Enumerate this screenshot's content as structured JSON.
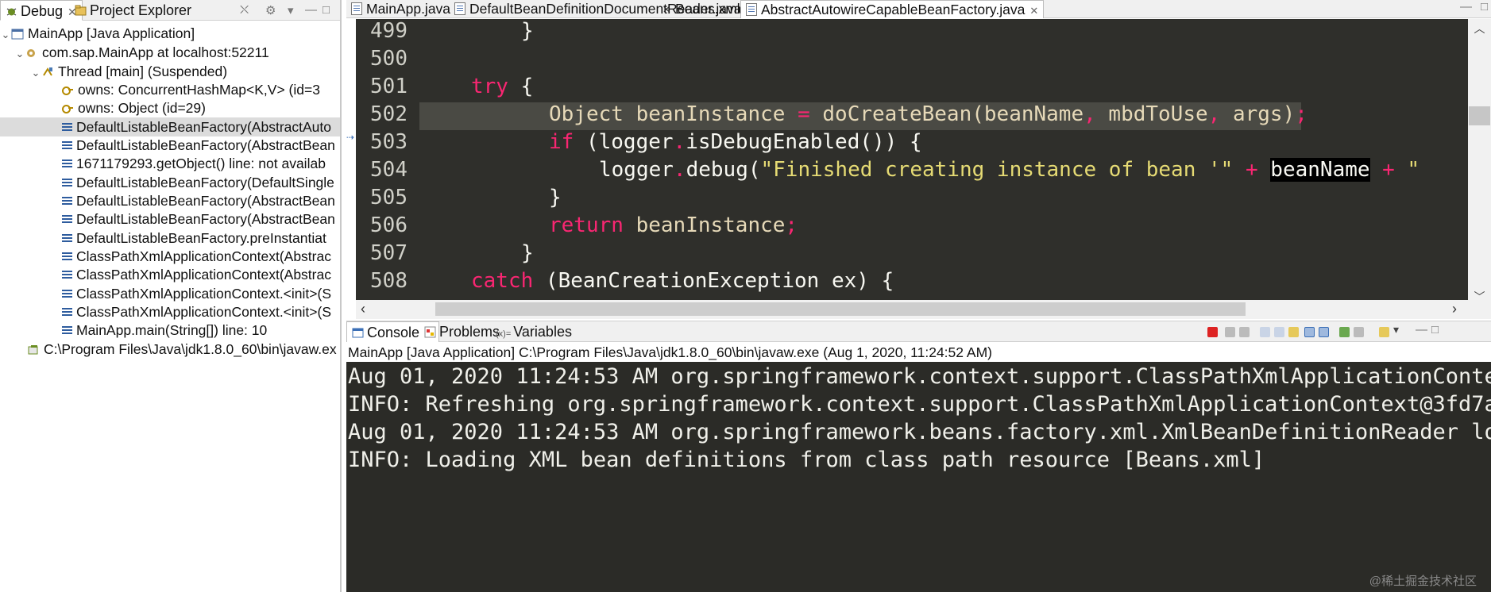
{
  "debug_view": {
    "tabs": [
      {
        "label": "Debug",
        "active": true
      },
      {
        "label": "Project Explorer",
        "active": false
      }
    ],
    "tree": [
      {
        "label": "MainApp [Java Application]",
        "level": 0,
        "expanded": true,
        "icon": "launch-icon"
      },
      {
        "label": "com.sap.MainApp at localhost:52211",
        "level": 1,
        "expanded": true,
        "icon": "target-icon"
      },
      {
        "label": "Thread [main] (Suspended)",
        "level": 2,
        "expanded": true,
        "icon": "thread-icon"
      },
      {
        "label": "owns: ConcurrentHashMap<K,V>  (id=3",
        "level": 3,
        "icon": "monitor-icon"
      },
      {
        "label": "owns: Object  (id=29)",
        "level": 3,
        "icon": "monitor-icon"
      },
      {
        "label": "DefaultListableBeanFactory(AbstractAuto",
        "level": 3,
        "icon": "stack-frame-icon",
        "selected": true
      },
      {
        "label": "DefaultListableBeanFactory(AbstractBean",
        "level": 3,
        "icon": "stack-frame-icon"
      },
      {
        "label": "1671179293.getObject() line: not availab",
        "level": 3,
        "icon": "stack-frame-icon"
      },
      {
        "label": "DefaultListableBeanFactory(DefaultSingle",
        "level": 3,
        "icon": "stack-frame-icon"
      },
      {
        "label": "DefaultListableBeanFactory(AbstractBean",
        "level": 3,
        "icon": "stack-frame-icon"
      },
      {
        "label": "DefaultListableBeanFactory(AbstractBean",
        "level": 3,
        "icon": "stack-frame-icon"
      },
      {
        "label": "DefaultListableBeanFactory.preInstantiat",
        "level": 3,
        "icon": "stack-frame-icon"
      },
      {
        "label": "ClassPathXmlApplicationContext(Abstrac",
        "level": 3,
        "icon": "stack-frame-icon"
      },
      {
        "label": "ClassPathXmlApplicationContext(Abstrac",
        "level": 3,
        "icon": "stack-frame-icon"
      },
      {
        "label": "ClassPathXmlApplicationContext.<init>(S",
        "level": 3,
        "icon": "stack-frame-icon"
      },
      {
        "label": "ClassPathXmlApplicationContext.<init>(S",
        "level": 3,
        "icon": "stack-frame-icon"
      },
      {
        "label": "MainApp.main(String[]) line: 10",
        "level": 3,
        "icon": "stack-frame-icon"
      },
      {
        "label": "C:\\Program Files\\Java\\jdk1.8.0_60\\bin\\javaw.ex",
        "level": 1,
        "icon": "process-icon"
      }
    ]
  },
  "editor": {
    "tabs": [
      {
        "label": "MainApp.java",
        "icon": "java-file-icon",
        "active": false
      },
      {
        "label": "DefaultBeanDefinitionDocumentReader.java",
        "icon": "java-file-icon",
        "active": false
      },
      {
        "label": "Beans.xml",
        "icon": "xml-file-icon",
        "active": false
      },
      {
        "label": "AbstractAutowireCapableBeanFactory.java",
        "icon": "java-file-icon",
        "active": true
      }
    ],
    "line_numbers": [
      "499",
      "500",
      "501",
      "502",
      "503",
      "504",
      "505",
      "506",
      "507",
      "508"
    ],
    "code": {
      "l499": "}",
      "l501_kw": "try",
      "l501_rest": " {",
      "l502_a": "Object beanInstance ",
      "l502_eq": "=",
      "l502_b": " doCreateBean(beanName",
      "l502_c1": ",",
      "l502_d": " mbdToUse",
      "l502_c2": ",",
      "l502_e": " args)",
      "l502_semi": ";",
      "l503_kw": "if",
      "l503_rest": " (logger",
      "l503_dot": ".",
      "l503_rest2": "isDebugEnabled()) {",
      "l504_a": "logger",
      "l504_dot": ".",
      "l504_b": "debug(",
      "l504_str": "\"Finished creating instance of bean '\"",
      "l504_plus1": " + ",
      "l504_sel": "beanName",
      "l504_plus2": " + ",
      "l504_tail": "\"",
      "l505": "}",
      "l506_kw": "return",
      "l506_rest": " beanInstance",
      "l506_semi": ";",
      "l507": "}",
      "l508_kw": "catch",
      "l508_rest": " (BeanCreationException ex) {"
    }
  },
  "console": {
    "tabs": [
      {
        "label": "Console",
        "active": true
      },
      {
        "label": "Problems",
        "active": false
      },
      {
        "label": "Variables",
        "active": false
      }
    ],
    "title": "MainApp [Java Application] C:\\Program Files\\Java\\jdk1.8.0_60\\bin\\javaw.exe (Aug 1, 2020, 11:24:52 AM)",
    "lines": [
      "Aug 01, 2020 11:24:53 AM org.springframework.context.support.ClassPathXmlApplicationConte",
      "INFO: Refreshing org.springframework.context.support.ClassPathXmlApplicationContext@3fd7a",
      "Aug 01, 2020 11:24:53 AM org.springframework.beans.factory.xml.XmlBeanDefinitionReader lo",
      "INFO: Loading XML bean definitions from class path resource [Beans.xml]"
    ]
  },
  "watermark": "@稀土掘金技术社区",
  "colors": {
    "editor_bg": "#2f2f2b",
    "keyword": "#f92672",
    "string": "#e6db74",
    "console_bg": "#2b2b27",
    "selection": "#dcdcdc"
  }
}
